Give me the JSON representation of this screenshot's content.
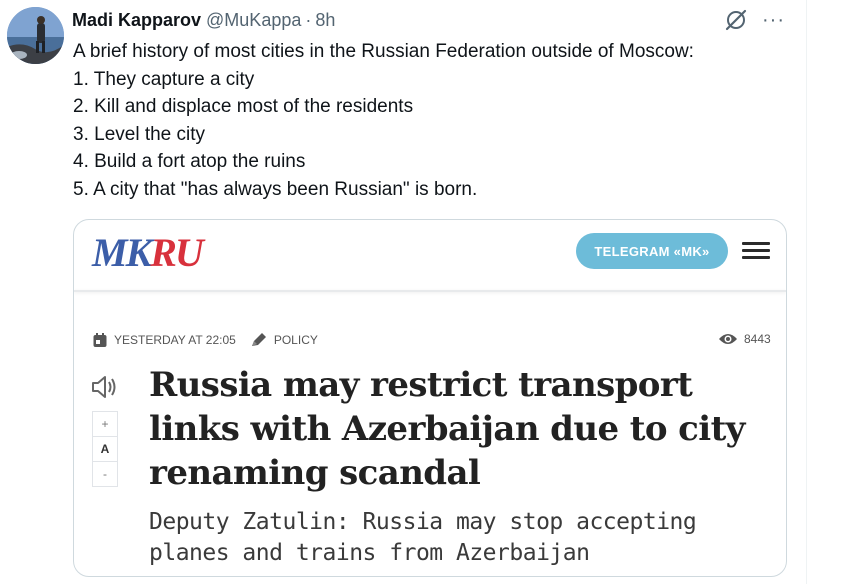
{
  "tweet": {
    "author_name": "Madi Kapparov",
    "author_handle": "@MuKappa",
    "separator": "·",
    "time": "8h",
    "lines": [
      "A brief history of most cities in the Russian Federation outside of Moscow:",
      "1. They capture a city",
      "2. Kill and displace most of the residents",
      "3. Level the city",
      "4. Build a fort atop the ruins",
      "5. A city that \"has always been Russian\" is born."
    ],
    "icons": {
      "grok": "grok-icon",
      "more": "more-options-icon"
    },
    "more_glyph": "···"
  },
  "card": {
    "logo_mk": "MK",
    "logo_ru": "RU",
    "telegram_button": "TELEGRAM «MK»",
    "date": "YESTERDAY AT 22:05",
    "category": "POLICY",
    "views": "8443",
    "font_increase": "+",
    "font_reset": "A",
    "font_decrease": "-",
    "headline": "Russia may restrict transport links with Azerbaijan due to city renaming scandal",
    "subheadline": "Deputy Zatulin: Russia may stop accepting planes and trains from Azerbaijan",
    "colors": {
      "logo_blue": "#3c5ea8",
      "logo_red": "#d8313c",
      "telegram": "#6dbcd9"
    }
  }
}
